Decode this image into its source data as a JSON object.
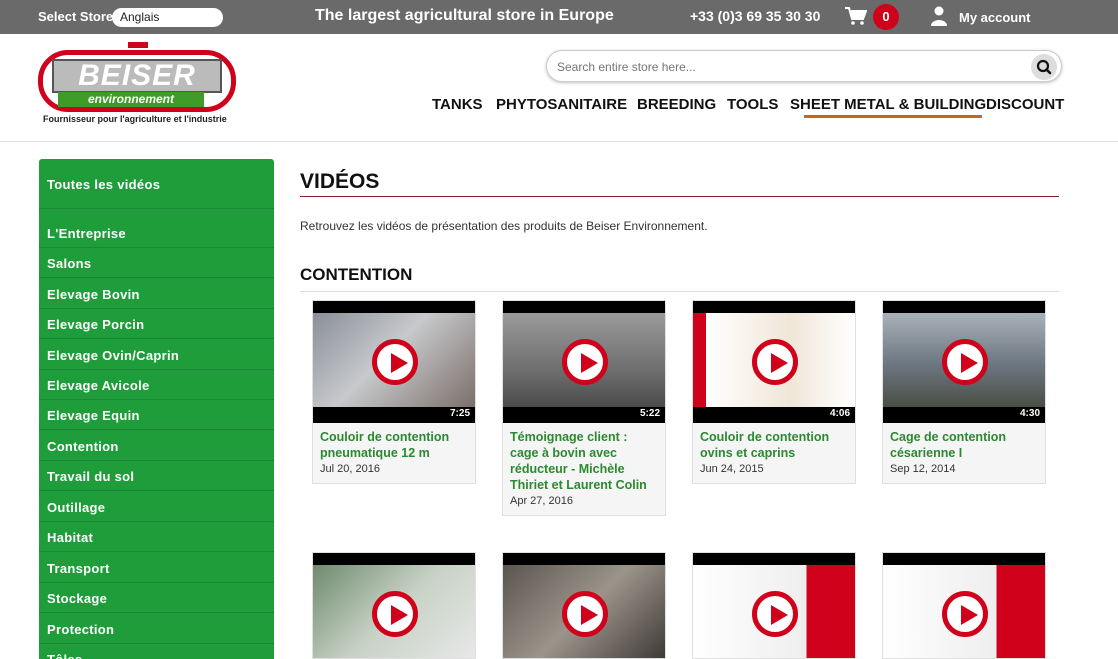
{
  "topbar": {
    "store_label": "Select Store",
    "store_value": "Anglais",
    "tagline": "The largest agricultural store in Europe",
    "phone": "+33 (0)3 69 35 30 30",
    "cart_count": "0",
    "account_label": "My account"
  },
  "logo": {
    "name": "BEISER",
    "sub": "environnement",
    "tagline": "Fournisseur pour l'agriculture et l'industrie"
  },
  "search": {
    "placeholder": "Search entire store here..."
  },
  "nav": {
    "items": [
      "TANKS",
      "PHYTOSANITAIRE",
      "BREEDING",
      "TOOLS",
      "SHEET METAL & BUILDING",
      "DISCOUNT"
    ],
    "active_index": 4
  },
  "sidebar": {
    "items": [
      "Toutes les vidéos",
      "L'Entreprise",
      "Salons",
      "Elevage Bovin",
      "Elevage Porcin",
      "Elevage Ovin/Caprin",
      "Elevage Avicole",
      "Elevage Equin",
      "Contention",
      "Travail du sol",
      "Outillage",
      "Habitat",
      "Transport",
      "Stockage",
      "Protection",
      "Tôles"
    ]
  },
  "page": {
    "title": "VIDÉOS",
    "intro": "Retrouvez les vidéos de présentation des produits de Beiser Environnement.",
    "section": "CONTENTION"
  },
  "videos": [
    {
      "title": "Couloir de contention pneumatique 12 m",
      "date": "Jul 20, 2016",
      "duration": "7:25"
    },
    {
      "title": "Témoignage client : cage à bovin avec réducteur - Michèle Thiriet et Laurent Colin",
      "date": "Apr 27, 2016",
      "duration": "5:22"
    },
    {
      "title": "Couloir de contention ovins et caprins",
      "date": "Jun 24, 2015",
      "duration": "4:06"
    },
    {
      "title": "Cage de contention césarienne I",
      "date": "Sep 12, 2014",
      "duration": "4:30"
    }
  ],
  "colors": {
    "brand_red": "#d0021b",
    "brand_green": "#1f9d3a",
    "topbar_gray": "#6a6a6a",
    "nav_underline": "#c9641a"
  }
}
